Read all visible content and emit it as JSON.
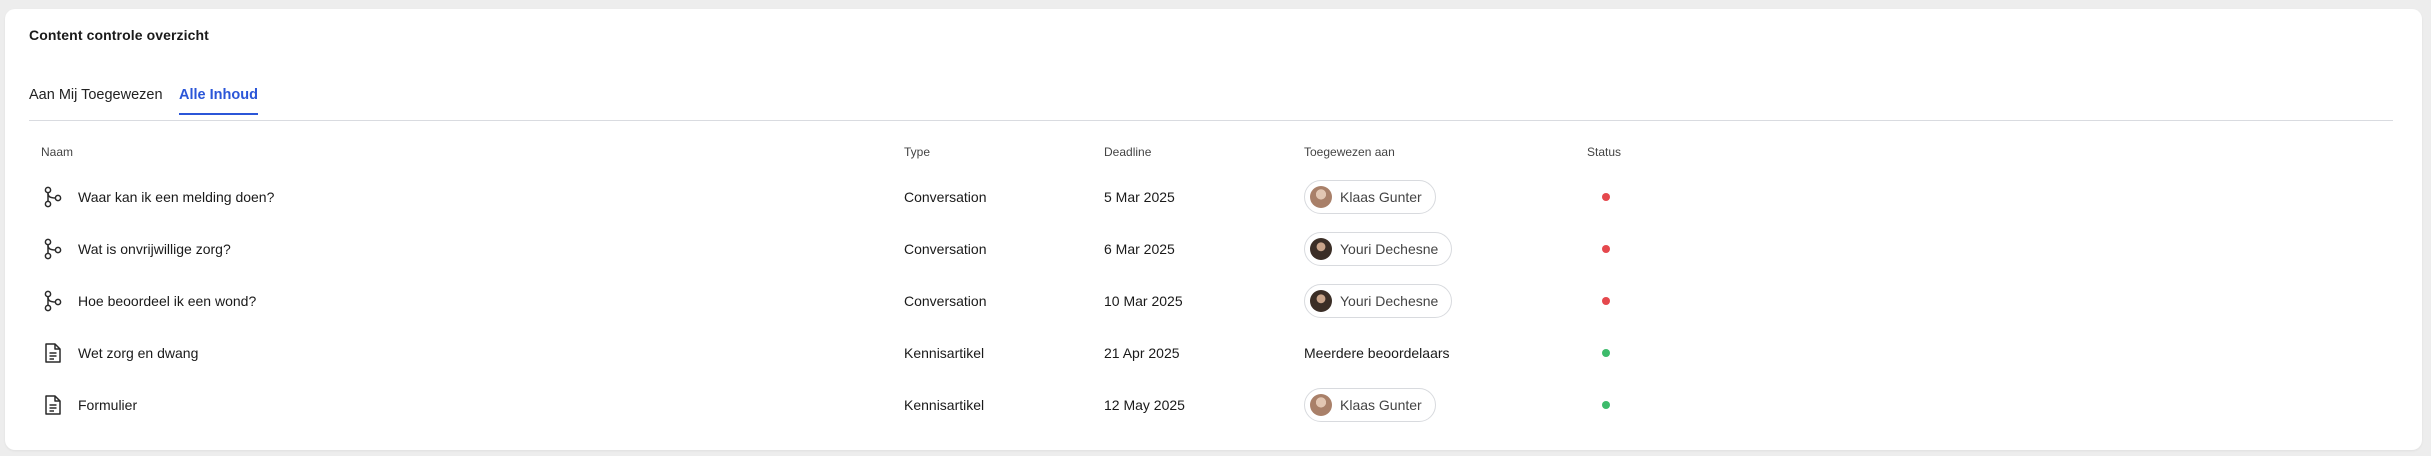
{
  "header": {
    "title": "Content controle overzicht"
  },
  "tabs": [
    {
      "label": "Aan Mij Toegewezen",
      "active": false
    },
    {
      "label": "Alle Inhoud",
      "active": true
    }
  ],
  "columns": {
    "name": "Naam",
    "type": "Type",
    "deadline": "Deadline",
    "assigned": "Toegewezen aan",
    "status": "Status"
  },
  "rows": [
    {
      "icon": "flow-branch-icon",
      "name": "Waar kan ik een melding doen?",
      "type": "Conversation",
      "deadline": "5 Mar 2025",
      "assignee": "Klaas Gunter",
      "status": "red"
    },
    {
      "icon": "flow-branch-icon",
      "name": "Wat is onvrijwillige zorg?",
      "type": "Conversation",
      "deadline": "6 Mar 2025",
      "assignee": "Youri Dechesne",
      "status": "red"
    },
    {
      "icon": "flow-branch-icon",
      "name": "Hoe beoordeel ik een wond?",
      "type": "Conversation",
      "deadline": "10 Mar 2025",
      "assignee": "Youri Dechesne",
      "status": "red"
    },
    {
      "icon": "document-icon",
      "name": "Wet zorg en dwang",
      "type": "Kennisartikel",
      "deadline": "21 Apr 2025",
      "assignee_text": "Meerdere beoordelaars",
      "status": "green"
    },
    {
      "icon": "document-icon",
      "name": "Formulier",
      "type": "Kennisartikel",
      "deadline": "12 May 2025",
      "assignee": "Klaas Gunter",
      "status": "green"
    }
  ],
  "colors": {
    "accent": "#2b56d8",
    "status_red": "#e5484d",
    "status_green": "#3dbb6b",
    "avatar_klaas": "#b8957c",
    "avatar_youri": "#4a3a30"
  }
}
